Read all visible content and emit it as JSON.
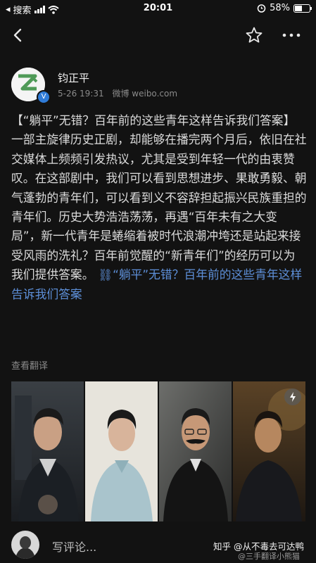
{
  "status": {
    "carrier": "搜索",
    "time": "20:01",
    "battery": "58%",
    "battery_level": 0.58
  },
  "nav": {
    "back_icon": "chevron-left-icon",
    "star_icon": "star-outline-icon",
    "more_icon": "more-dots-icon"
  },
  "author": {
    "name": "钧正平",
    "avatar_text": "钧正平",
    "date": "5-26 19:31",
    "source": "微博 weibo.com"
  },
  "post": {
    "text": "【“躺平”无错？百年前的这些青年这样告诉我们答案】一部主旋律历史正剧，却能够在播完两个月后，依旧在社交媒体上频频引发热议，尤其是受到年轻一代的由衷赞叹。在这部剧中，我们可以看到思想进步、果敢勇毅、朝气蓬勃的青年们，可以看到义不容辞担起振兴民族重担的青年们。历史大势浩浩荡荡，再遇“百年未有之大变局”，新一代青年是蜷缩着被时代浪潮冲垮还是站起来接受风雨的洗礼？百年前觉醒的“新青年们”的经历可以为我们提供答案。",
    "link_text": "“躺平”无错？百年前的这些青年这样告诉我们答案",
    "translate": "查看翻译",
    "accent_color": "#5d8fd8"
  },
  "photos": [
    {
      "name": "photo-1"
    },
    {
      "name": "photo-2"
    },
    {
      "name": "photo-3"
    },
    {
      "name": "photo-4",
      "badge_icon": "live-photo-icon"
    }
  ],
  "comment": {
    "placeholder": "写评论...",
    "watermark_line1": "知乎 @从不毒去可达鸭",
    "watermark_line2": "@三手翻译小熊猫"
  }
}
